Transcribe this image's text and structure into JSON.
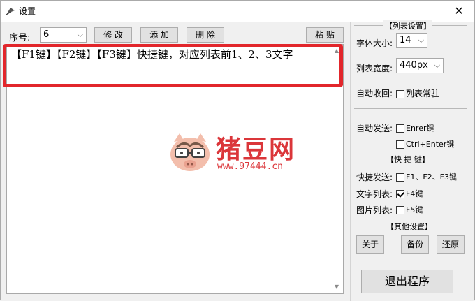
{
  "window": {
    "title": "设置",
    "close_glyph": "✕"
  },
  "toolbar": {
    "seq_label": "序号:",
    "seq_value": "6",
    "modify": "修 改",
    "add": "添 加",
    "delete": "删 除",
    "paste": "粘 贴"
  },
  "editor": {
    "text": "【F1键】【F2键】【F3键】快捷键，对应列表前1、2、3文字"
  },
  "settings": {
    "list_group": "【列表设置】",
    "font_size_label": "字体大小:",
    "font_size_value": "14",
    "list_width_label": "列表宽度:",
    "list_width_value": "440px",
    "auto_collapse_label": "自动收回:",
    "list_pinned": "列表常驻",
    "auto_send_label": "自动发送:",
    "enter_key": "Enrer键",
    "ctrl_enter_key": "Ctrl+Enter键",
    "shortcut_group": "【快 捷 键】",
    "shortcut_send_label": "快捷发送:",
    "f123_key": "F1、F2、F3键",
    "text_list_label": "文字列表:",
    "f4_key": "F4键",
    "image_list_label": "图片列表:",
    "f5_key": "F5键",
    "other_group": "【其他设置】",
    "about": "关于",
    "backup": "备份",
    "restore": "还原",
    "exit": "退出程序"
  },
  "state": {
    "list_pinned_checked": false,
    "enter_checked": false,
    "ctrl_enter_checked": false,
    "f123_checked": false,
    "f4_checked": true,
    "f5_checked": false
  },
  "watermark": {
    "brand": "猪豆网",
    "url": "www.97444.cn"
  },
  "colors": {
    "highlight": "#e2262b",
    "watermark": "#d9262a"
  }
}
